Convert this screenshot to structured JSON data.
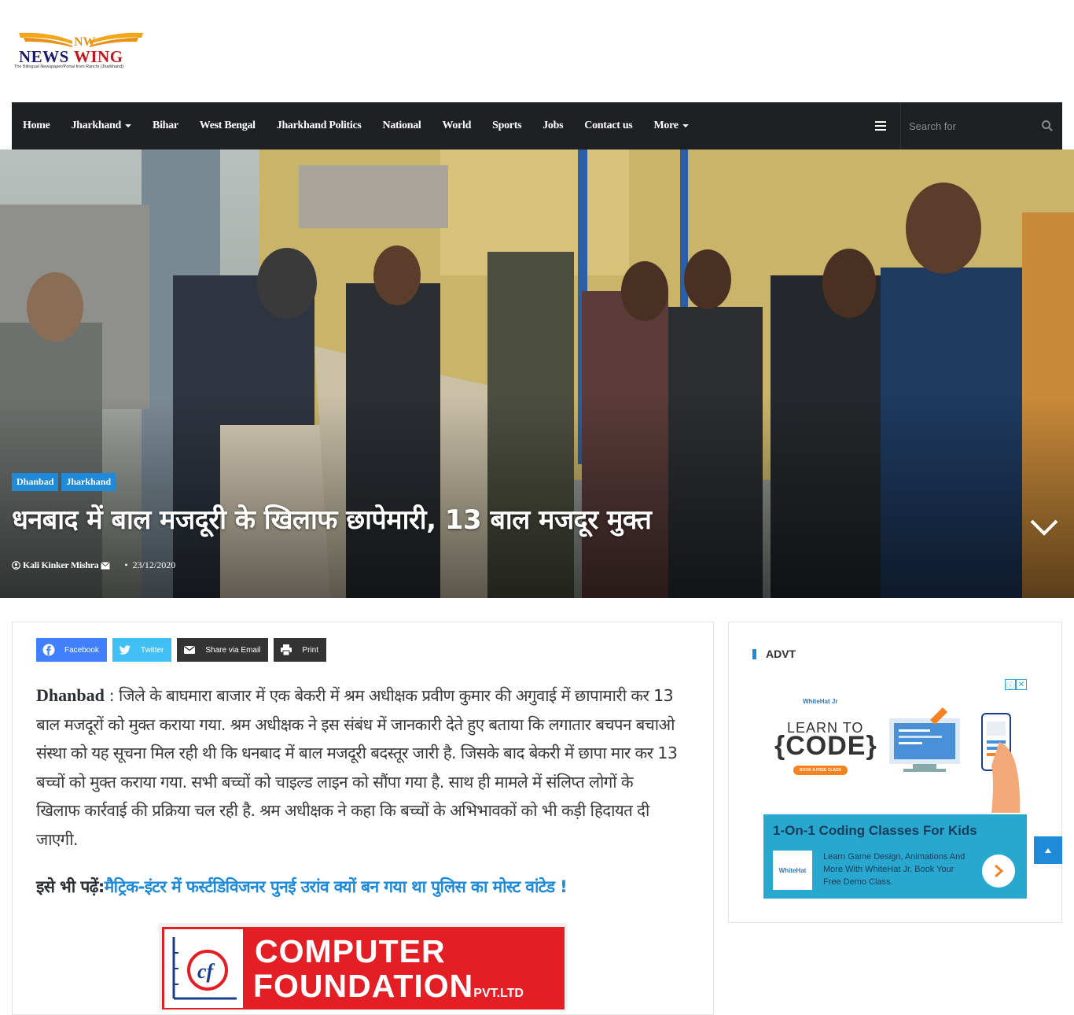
{
  "site": {
    "logo_text_1": "NEWS",
    "logo_text_2": "WING",
    "logo_initials": "NW",
    "tagline": "The Bilingual Newspaper/Portal from Ranchi (Jharkhand)"
  },
  "nav": {
    "items": [
      {
        "label": "Home",
        "has_dropdown": false
      },
      {
        "label": "Jharkhand",
        "has_dropdown": true
      },
      {
        "label": "Bihar",
        "has_dropdown": false
      },
      {
        "label": "West Bengal",
        "has_dropdown": false
      },
      {
        "label": "Jharkhand Politics",
        "has_dropdown": false
      },
      {
        "label": "National",
        "has_dropdown": false
      },
      {
        "label": "World",
        "has_dropdown": false
      },
      {
        "label": "Sports",
        "has_dropdown": false
      },
      {
        "label": "Jobs",
        "has_dropdown": false
      },
      {
        "label": "Contact us",
        "has_dropdown": false
      },
      {
        "label": "More",
        "has_dropdown": true
      }
    ],
    "search_placeholder": "Search for"
  },
  "hero": {
    "categories": [
      "Dhanbad",
      "Jharkhand"
    ],
    "title": "धनबाद में बाल मजदूरी के खिलाफ छापेमारी, 13 बाल मजदूर मुक्त",
    "author": "Kali Kinker Mishra",
    "date": "23/12/2020"
  },
  "share": {
    "facebook": "Facebook",
    "twitter": "Twitter",
    "email": "Share via Email",
    "print": "Print"
  },
  "article": {
    "lead": "Dhanbad",
    "body": " : जिले के  बाघमारा बाजार में एक बेकरी में श्रम अधीक्षक प्रवीण कुमार की अगुवाई में छापामारी कर 13 बाल मजदूरों को मुक्त कराया गया. श्रम अधीक्षक ने इस संबंध में जानकारी देते हुए बताया कि लगातार बचपन बचाओ संस्था को यह सूचना मिल रही थी कि धनबाद में बाल मजदूरी बदस्तूर जारी है. जिसके बाद बेकरी में छापा मार कर 13 बच्चों को मुक्त कराया गया. सभी बच्चों को चाइल्ड लाइन को सौंपा गया है. साथ ही मामले में संलिप्त लोगों के खिलाफ कार्रवाई की प्रक्रिया चल रही है. श्रम अधीक्षक ने कहा कि बच्चों के अभिभावकों को भी कड़ी हिदायत दी जाएगी.",
    "also_read_label": "इसे भी पढ़ें:",
    "also_read_link": "मैट्रिक-इंटर में फर्स्टडिविजनर पुनई उरांव क्यों बन गया था पुलिस का मोस्ट वांटेड !",
    "banner_line1": "COMPUTER",
    "banner_line2": "FOUNDATION",
    "banner_suffix": "PVT.LTD",
    "banner_logo": "cf"
  },
  "sidebar": {
    "title": "ADVT",
    "ad": {
      "brand": "WhiteHat Jr",
      "learn": "LEARN TO",
      "code": "{CODE}",
      "cta_small": "BOOK A FREE CLASS",
      "headline": "1-On-1 Coding Classes For Kids",
      "description": "Learn Game Design, Animations And More With WhiteHat Jr. Book Your Free Demo Class.",
      "logo_label": "WhiteHat"
    }
  },
  "colors": {
    "accent": "#1f8ad8",
    "nav_bg": "#1f2024",
    "logo_blue": "#1b1b6b",
    "logo_red": "#c4161c",
    "banner_red": "#e31e24"
  }
}
